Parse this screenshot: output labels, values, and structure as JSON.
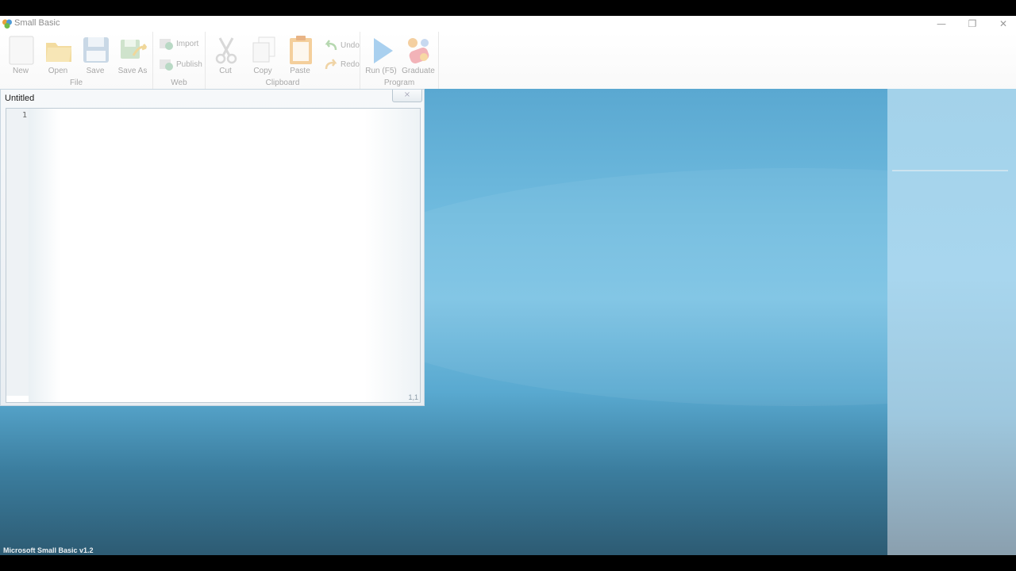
{
  "window": {
    "title": "Small Basic",
    "minimize": "—",
    "maximize": "❐",
    "close": "✕"
  },
  "ribbon": {
    "groups": {
      "file": {
        "label": "File",
        "new": "New",
        "open": "Open",
        "save": "Save",
        "save_as": "Save As"
      },
      "web": {
        "label": "Web",
        "import": "Import",
        "publish": "Publish"
      },
      "clipboard": {
        "label": "Clipboard",
        "cut": "Cut",
        "copy": "Copy",
        "paste": "Paste",
        "undo": "Undo",
        "redo": "Redo"
      },
      "program": {
        "label": "Program",
        "run": "Run (F5)",
        "graduate": "Graduate"
      }
    }
  },
  "editor": {
    "title": "Untitled",
    "close": "×",
    "line_numbers": [
      "1"
    ],
    "cursor_position": "1,1"
  },
  "status": {
    "version_text": "Microsoft Small Basic v1.2"
  },
  "colors": {
    "desktop_top": "#5aa8d1",
    "desktop_bottom": "#2d5b73",
    "ribbon_label": "#a8a8a8"
  }
}
